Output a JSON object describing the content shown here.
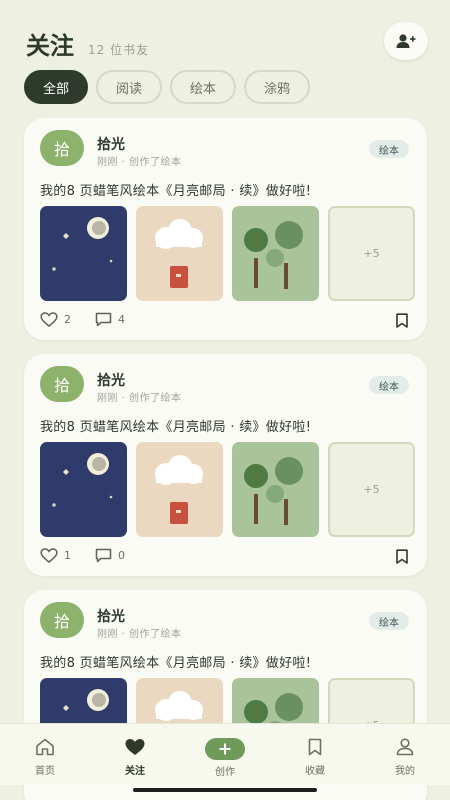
{
  "header": {
    "title": "关注",
    "subtitle": "12 位书友"
  },
  "tabs": [
    {
      "label": "全部",
      "active": true
    },
    {
      "label": "阅读",
      "active": false
    },
    {
      "label": "绘本",
      "active": false
    },
    {
      "label": "涂鸦",
      "active": false
    }
  ],
  "posts": [
    {
      "avatar_text": "拾",
      "author": "拾光",
      "time": "刚刚",
      "action": "创作了绘本",
      "badge": "绘本",
      "text": "我的8 页蜡笔风绘本《月亮邮局 · 续》做好啦!",
      "more_count": "+5",
      "likes": "2",
      "comments": "4"
    },
    {
      "avatar_text": "拾",
      "author": "拾光",
      "time": "刚刚",
      "action": "创作了绘本",
      "badge": "绘本",
      "text": "我的8 页蜡笔风绘本《月亮邮局 · 续》做好啦!",
      "more_count": "+5",
      "likes": "1",
      "comments": "0"
    },
    {
      "avatar_text": "拾",
      "author": "拾光",
      "time": "刚刚",
      "action": "创作了绘本",
      "badge": "绘本",
      "text": "我的8 页蜡笔风绘本《月亮邮局 · 续》做好啦!",
      "more_count": "+5",
      "likes": "",
      "comments": ""
    }
  ],
  "bottom_nav": [
    {
      "label": "首页",
      "icon": "home-icon",
      "active": false
    },
    {
      "label": "关注",
      "icon": "heart-icon",
      "active": true
    },
    {
      "label": "创作",
      "icon": "plus-icon",
      "active": false
    },
    {
      "label": "收藏",
      "icon": "bookmark-icon",
      "active": false
    },
    {
      "label": "我的",
      "icon": "user-icon",
      "active": false
    }
  ],
  "colors": {
    "background": "#eef0e2",
    "accent": "#6e9b5a",
    "dark": "#2e3b2c",
    "avatar": "#8db26c"
  }
}
